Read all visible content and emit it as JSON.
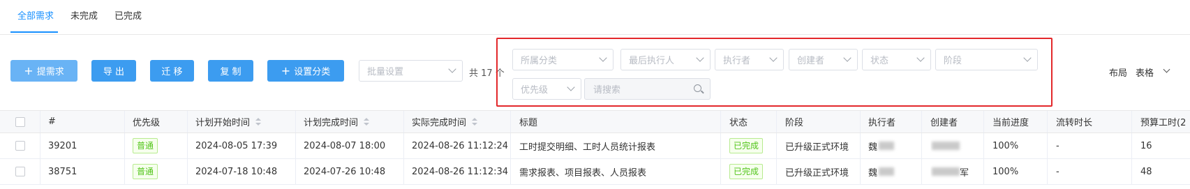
{
  "tabs": [
    {
      "label": "全部需求"
    },
    {
      "label": "未完成"
    },
    {
      "label": "已完成"
    }
  ],
  "toolbar": {
    "add_label": "提需求",
    "export_label": "导 出",
    "migrate_label": "迁 移",
    "copy_label": "复 制",
    "category_label": "设置分类",
    "batch_placeholder": "批量设置",
    "total_text": "共 17 个"
  },
  "filters": {
    "category": "所属分类",
    "last_executor": "最后执行人",
    "executor": "执行者",
    "creator": "创建者",
    "status": "状态",
    "stage": "阶段",
    "priority": "优先级",
    "search_placeholder": "请搜索"
  },
  "layout": {
    "label": "布局",
    "value": "表格"
  },
  "table": {
    "headers": {
      "id": "#",
      "priority": "优先级",
      "plan_start": "计划开始时间",
      "plan_end": "计划完成时间",
      "actual_end": "实际完成时间",
      "title": "标题",
      "status": "状态",
      "stage": "阶段",
      "executor": "执行者",
      "creator": "创建者",
      "progress": "当前进度",
      "duration": "流转时长",
      "budget_hours": "预算工时(2"
    },
    "rows": [
      {
        "id": "39201",
        "priority": "普通",
        "plan_start": "2024-08-05 17:39",
        "plan_end": "2024-08-07 18:00",
        "actual_end": "2024-08-26 11:12:24",
        "title": "工时提交明细、工时人员统计报表",
        "status": "已完成",
        "stage": "已升级正式环境",
        "executor": "魏",
        "creator": "",
        "progress": "100%",
        "duration": "-",
        "budget_hours": "16"
      },
      {
        "id": "38751",
        "priority": "普通",
        "plan_start": "2024-07-18 10:48",
        "plan_end": "2024-07-26 10:48",
        "actual_end": "2024-08-26 11:12:34",
        "title": "需求报表、项目报表、人员报表",
        "status": "已完成",
        "stage": "已升级正式环境",
        "executor": "魏",
        "creator": "军",
        "progress": "100%",
        "duration": "-",
        "budget_hours": "48"
      }
    ]
  },
  "colors": {
    "accent": "#1890ff",
    "button": "#3c9cf0",
    "highlight_border": "#e3282b",
    "status_green": "#52c41a"
  }
}
